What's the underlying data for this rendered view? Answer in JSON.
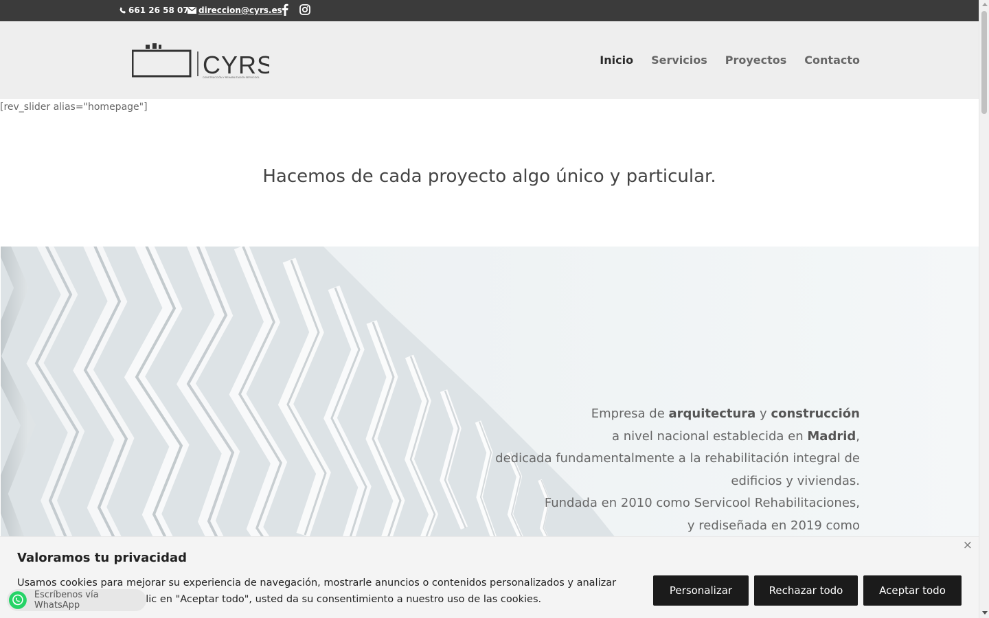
{
  "topbar": {
    "phone": "661 26 58 07",
    "email": "direccion@cyrs.es",
    "icons": [
      "phone-icon",
      "mail-icon",
      "facebook-icon",
      "instagram-icon"
    ]
  },
  "logo": {
    "name": "CYRS",
    "tagline": "CONSTRUCCIÓN Y REHABILITACIÓN SERVICOOL"
  },
  "nav": {
    "items": [
      "Inicio",
      "Servicios",
      "Proyectos",
      "Contacto"
    ],
    "active": "Inicio"
  },
  "shortcode": "[rev_slider alias=\"homepage\"]",
  "headline": "Hacemos de cada proyecto algo único y particular.",
  "hero": {
    "intro_pre": "Empresa de ",
    "intro_b1": "arquitectura",
    "intro_mid": " y ",
    "intro_b2": "construcción",
    "line2_pre": "a nivel nacional establecida en ",
    "line2_b": "Madrid",
    "line2_post": ",",
    "line3": "dedicada fundamentalmente a la rehabilitación integral de",
    "line4": "edificios y viviendas. ",
    "line5": "Fundada en 2010 como Servicool Rehabilitaciones,",
    "line6": "y rediseñada en 2019 como"
  },
  "cookie": {
    "title": "Valoramos tu privacidad",
    "text": "Usamos cookies para mejorar su experiencia de navegación, mostrarle anuncios o contenidos personalizados y analizar nuestro tráfico. Al hacer clic en \"Aceptar todo\", usted da su consentimiento a nuestro uso de las cookies.",
    "customize": "Personalizar",
    "reject": "Rechazar todo",
    "accept": "Aceptar todo",
    "close": "×"
  },
  "whatsapp": {
    "label": "Escríbenos vía WhatsApp"
  },
  "colors": {
    "topbar": "#3b3b3b",
    "header": "#eeeeee",
    "button": "#1b1b1b",
    "whatsapp": "#25d366"
  }
}
